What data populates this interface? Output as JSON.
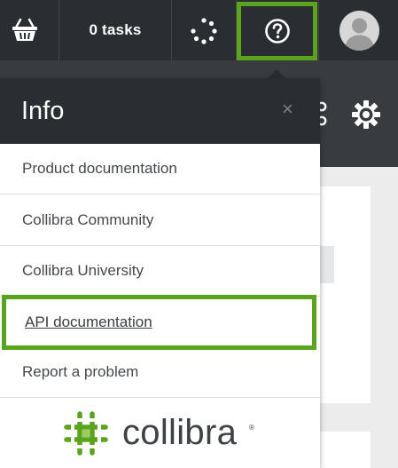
{
  "topbar": {
    "basket_icon": "basket-icon",
    "tasks_label": "0 tasks",
    "spinner_icon": "activity-spinner-icon",
    "help_icon": "question-circle-icon",
    "avatar_icon": "user-avatar-icon"
  },
  "subbar": {
    "icons": [
      "apps-icon",
      "gear-icon"
    ]
  },
  "dropdown": {
    "title": "Info",
    "close": "×",
    "items": [
      {
        "label": "Product documentation"
      },
      {
        "label": "Collibra Community"
      },
      {
        "label": "Collibra University"
      },
      {
        "label": "API documentation"
      },
      {
        "label": "Report a problem"
      }
    ],
    "logo_text": "collibra",
    "logo_mark": "®"
  },
  "colors": {
    "topbar": "#2a2d31",
    "subbar": "#383c41",
    "highlight": "#5aa31f",
    "logo_green": "#5aa31f",
    "background": "#ececec"
  }
}
